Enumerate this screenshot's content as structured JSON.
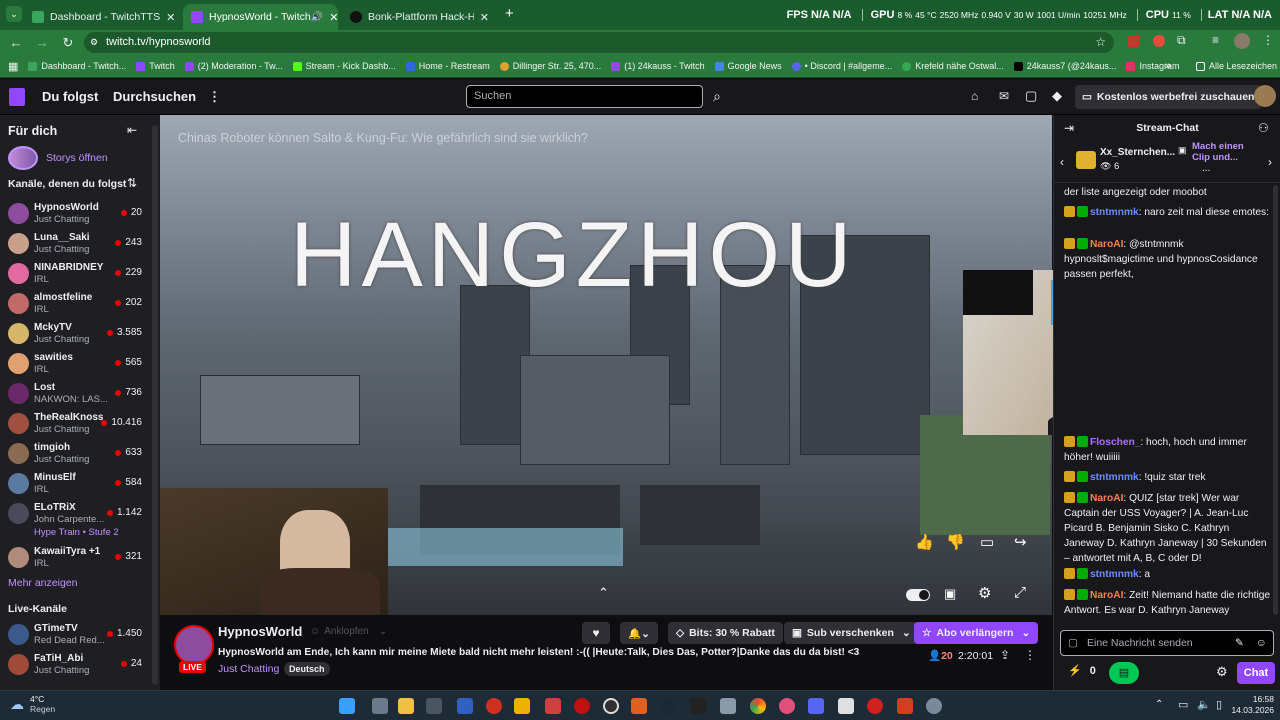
{
  "browser": {
    "tabs": [
      {
        "title": "Dashboard - TwitchTTS",
        "active": false
      },
      {
        "title": "HypnosWorld - Twitch",
        "active": true
      },
      {
        "title": "Bonk-Plattform Hack-Häufigke",
        "active": false
      }
    ],
    "new_tab": "+",
    "url": "twitch.tv/hypnosworld",
    "stats": {
      "fps_label": "FPS",
      "fps1": "N/A",
      "fps2": "N/A",
      "gpu_label": "GPU",
      "gpu_pct": "8 %",
      "gpu_temp": "45 °C",
      "gpu_mhz": "2520 MHz",
      "gpu_v": "0.940 V",
      "gpu_w": "30 W",
      "gpu_rpm": "1001 U/min",
      "gpu_mem": "10251 MHz",
      "cpu_label": "CPU",
      "cpu_pct": "11 %",
      "lat_label": "LAT",
      "lat1": "N/A",
      "lat2": "N/A"
    },
    "bookmarks": [
      "Dashboard - Twitch...",
      "Twitch",
      "(2) Moderation - Tw...",
      "Stream - Kick Dashb...",
      "Home - Restream",
      "Dillinger Str. 25, 470...",
      "(1) 24kauss - Twitch",
      "Google News",
      "• Discord | #allgeme...",
      "Krefeld nähe Ostwal...",
      "24kauss7 (@24kaus...",
      "Instagram"
    ],
    "bookmarks_more": "»",
    "all_bookmarks": "Alle Lesezeichen"
  },
  "twitch": {
    "nav_following": "Du folgst",
    "nav_browse": "Durchsuchen",
    "search_placeholder": "Suchen",
    "adfree": "Kostenlos werbefrei zuschauen"
  },
  "sidebar": {
    "for_you": "Für dich",
    "stories": "Storys öffnen",
    "followed_heading": "Kanäle, denen du folgst",
    "channels": [
      {
        "name": "HypnosWorld",
        "game": "Just Chatting",
        "viewers": "20",
        "color": "#8e4c9e"
      },
      {
        "name": "Luna__Saki",
        "game": "Just Chatting",
        "viewers": "243",
        "color": "#c9a08a"
      },
      {
        "name": "NINABRIDNEY",
        "game": "IRL",
        "viewers": "229",
        "color": "#e36aa0"
      },
      {
        "name": "almostfeline",
        "game": "IRL",
        "viewers": "202",
        "color": "#c06a6a"
      },
      {
        "name": "MckyTV",
        "game": "Just Chatting",
        "viewers": "3.585",
        "color": "#d6b66a"
      },
      {
        "name": "sawities",
        "game": "IRL",
        "viewers": "565",
        "color": "#e0a070"
      },
      {
        "name": "Lost",
        "game": "NAKWON: LAS...",
        "viewers": "736",
        "color": "#6a2a6a"
      },
      {
        "name": "TheRealKnossi",
        "game": "Just Chatting",
        "viewers": "10.416",
        "color": "#a05040"
      },
      {
        "name": "timgioh",
        "game": "Just Chatting",
        "viewers": "633",
        "color": "#8a6a50"
      },
      {
        "name": "MinusElf",
        "game": "IRL",
        "viewers": "584",
        "color": "#5a7aa0"
      },
      {
        "name": "ELoTRiX",
        "game": "John Carpente...",
        "viewers": "1.142",
        "color": "#4a4a5a"
      },
      {
        "name": "KawaiiTyra +1",
        "game": "IRL",
        "viewers": "321",
        "color": "#b08a7a"
      }
    ],
    "hype_train": "Hype Train • Stufe 2",
    "show_more": "Mehr anzeigen",
    "live_heading": "Live-Kanäle",
    "live_channels": [
      {
        "name": "GTimeTV",
        "game": "Red Dead Red...",
        "viewers": "1.450",
        "color": "#3a5a8a"
      },
      {
        "name": "FaTiH_Abi",
        "game": "Just Chatting",
        "viewers": "24",
        "color": "#a04a3a"
      }
    ]
  },
  "video": {
    "title": "Chinas Roboter können Salto & Kung-Fu: Wie gefährlich sind sie wirklich?",
    "overlay_text": "HANGZHOU"
  },
  "stream_info": {
    "streamer": "HypnosWorld",
    "knock": "Anklopfen",
    "bits_label": "Bits: 30 % Rabatt",
    "gift_sub": "Sub verschenken",
    "renew_sub": "Abo verlängern",
    "title": "HypnosWorld am Ende, Ich kann mir meine Miete bald nicht mehr leisten! :-(( |Heute:Talk, Dies Das, Potter?|Danke das du da bist! <3",
    "category": "Just Chatting",
    "language_tag": "Deutsch",
    "live_badge": "LIVE",
    "viewers": "20",
    "uptime": "2:20:01"
  },
  "chat": {
    "header": "Stream-Chat",
    "pinned_user": "Xx_Sternchen...",
    "pinned_count": "6",
    "pinned_text": "Mach einen Clip und...",
    "pinned_more": "...",
    "messages": [
      {
        "user": "",
        "text": "der liste angezeigt oder moobot",
        "color": "#efeff1"
      },
      {
        "user": "stntmnmk",
        "text": ": naro zeit mal diese emotes:",
        "color": "#6b8cff"
      },
      {
        "user": "NaroAI",
        "text": ": @stntmnmk hypnoslt$magictime und hypnosCosidance passen perfekt,",
        "color": "#ff7f50"
      },
      {
        "user": "Floschen_",
        "text": ": hoch, hoch und immer höher! wuiiiii",
        "color": "#a970ff"
      },
      {
        "user": "stntmnmk",
        "text": ": !quiz star trek",
        "color": "#6b8cff"
      },
      {
        "user": "NaroAI",
        "text": ": QUIZ [star trek] Wer war Captain der USS Voyager? | A. Jean-Luc Picard B. Benjamin Sisko C. Kathryn Janeway D. Kathryn Janeway | 30 Sekunden – antwortet mit A, B, C oder D!",
        "color": "#ff7f50"
      },
      {
        "user": "stntmnmk",
        "text": ": a",
        "color": "#6b8cff"
      },
      {
        "user": "NaroAI",
        "text": ": Zeit! Niemand hatte die richtige Antwort. Es war D. Kathryn Janeway",
        "color": "#ff7f50"
      }
    ],
    "input_placeholder": "Eine Nachricht senden",
    "points": "0",
    "send_label": "Chat"
  },
  "taskbar": {
    "weather_temp": "4°C",
    "weather_text": "Regen",
    "time": "16:58",
    "date": "14.03.2026"
  }
}
